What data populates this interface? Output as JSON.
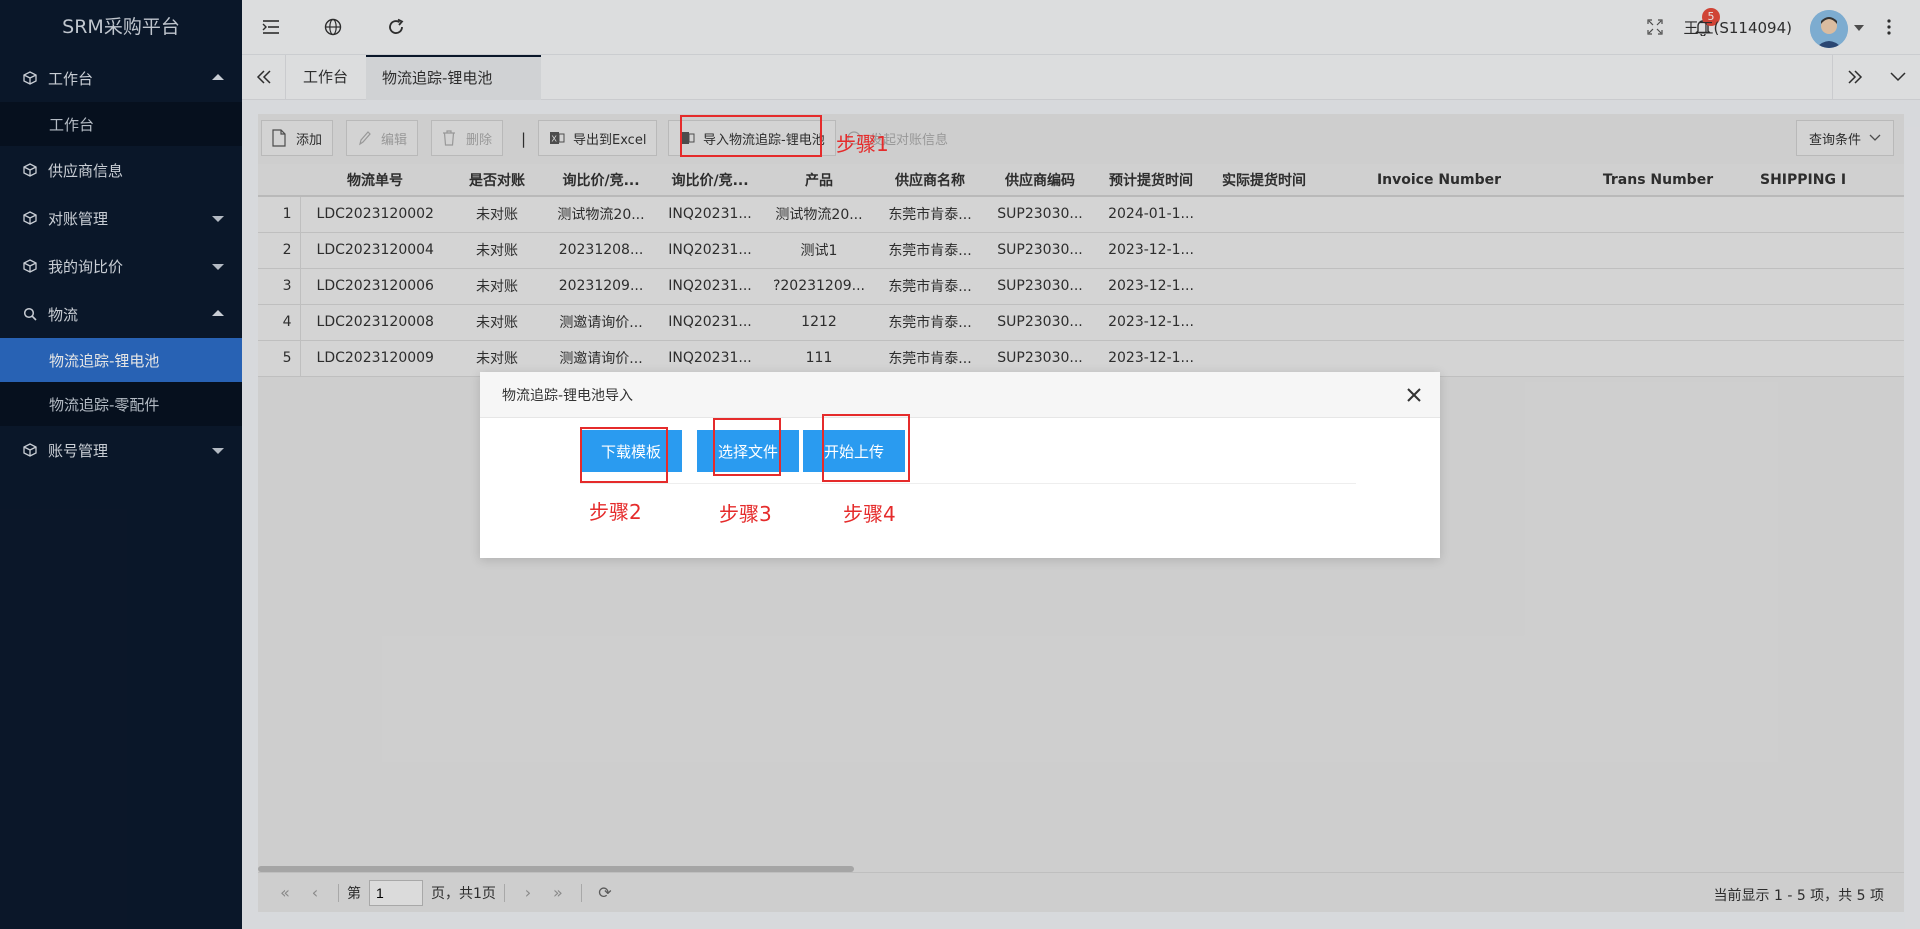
{
  "app": {
    "title": "SRM采购平台"
  },
  "sidebar": {
    "groups": [
      {
        "label": "工作台",
        "expanded": true,
        "children": [
          {
            "label": "工作台"
          }
        ]
      },
      {
        "label": "供应商信息"
      },
      {
        "label": "对账管理"
      },
      {
        "label": "我的询比价"
      },
      {
        "label": "物流",
        "expanded": true,
        "children": [
          {
            "label": "物流追踪-锂电池",
            "active": true
          },
          {
            "label": "物流追踪-零配件"
          }
        ]
      },
      {
        "label": "账号管理"
      }
    ]
  },
  "header": {
    "notifications": "5",
    "user": "王工(S114094)"
  },
  "tabs": [
    {
      "label": "工作台"
    },
    {
      "label": "物流追踪-锂电池",
      "active": true,
      "close": "×"
    }
  ],
  "toolbar": {
    "add": "添加",
    "edit": "编辑",
    "delete": "删除",
    "separator": "|",
    "export": "导出到Excel",
    "import": "导入物流追踪-锂电池",
    "initiate": "发起对账信息",
    "query": "查询条件"
  },
  "table": {
    "columns": [
      "",
      "物流单号",
      "是否对账",
      "询比价/竞...",
      "询比价/竞...",
      "产品",
      "供应商名称",
      "供应商编码",
      "预计提货时间",
      "实际提货时间",
      "Invoice Number",
      "Trans Number",
      "SHIPPING I"
    ],
    "rows": [
      [
        "1",
        "LDC2023120002",
        "未对账",
        "测试物流20...",
        "INQ20231...",
        "测试物流20...",
        "东莞市肯泰...",
        "SUP23030...",
        "2024-01-1...",
        "",
        "",
        "",
        ""
      ],
      [
        "2",
        "LDC2023120004",
        "未对账",
        "20231208...",
        "INQ20231...",
        "测试1",
        "东莞市肯泰...",
        "SUP23030...",
        "2023-12-1...",
        "",
        "",
        "",
        ""
      ],
      [
        "3",
        "LDC2023120006",
        "未对账",
        "20231209...",
        "INQ20231...",
        "?20231209...",
        "东莞市肯泰...",
        "SUP23030...",
        "2023-12-1...",
        "",
        "",
        "",
        ""
      ],
      [
        "4",
        "LDC2023120008",
        "未对账",
        "测邀请询价...",
        "INQ20231...",
        "1212",
        "东莞市肯泰...",
        "SUP23030...",
        "2023-12-1...",
        "",
        "",
        "",
        ""
      ],
      [
        "5",
        "LDC2023120009",
        "未对账",
        "测邀请询价...",
        "INQ20231...",
        "111",
        "东莞市肯泰...",
        "SUP23030...",
        "2023-12-1...",
        "",
        "",
        "",
        ""
      ]
    ]
  },
  "pager": {
    "page_prefix": "第",
    "page_value": "1",
    "page_suffix": "页，共1页",
    "summary": "当前显示 1 - 5 项，共 5 项"
  },
  "modal": {
    "title": "物流追踪-锂电池导入",
    "download": "下载模板",
    "choose": "选择文件",
    "upload": "开始上传"
  },
  "annotations": {
    "step1": "步骤1",
    "step2": "步骤2",
    "step3": "步骤3",
    "step4": "步骤4",
    "color": "#e52b2b"
  },
  "colors": {
    "sidebar_bg": "#0c1a2e",
    "active_item": "#2d6ec9",
    "primary_button": "#2a9bf0",
    "badge": "#e84c3d"
  }
}
